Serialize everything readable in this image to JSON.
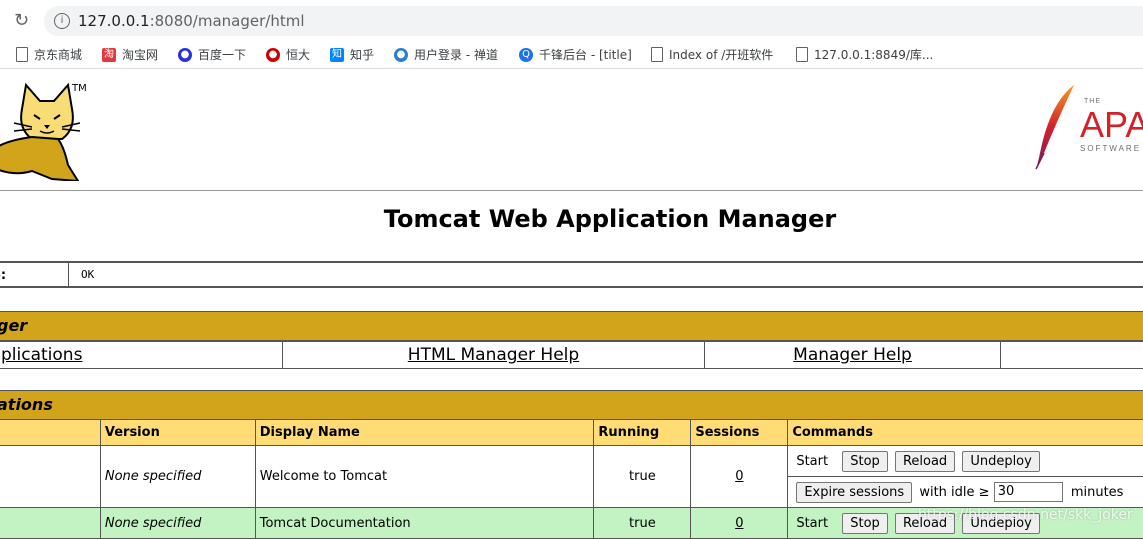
{
  "browser": {
    "url_host": "127.0.0.1",
    "url_rest": ":8080/manager/html",
    "bookmarks": [
      "京东商城",
      "淘宝网",
      "百度一下",
      "恒大",
      "知乎",
      "用户登录 - 禅道",
      "千锋后台 - [title]",
      "Index of /开班软件",
      "127.0.0.1:8849/库..."
    ]
  },
  "header": {
    "title": "Tomcat Web Application Manager",
    "tm": "TM"
  },
  "message": {
    "label": "e:",
    "value": "OK"
  },
  "manager_section": {
    "title": "ger",
    "links": [
      "plications",
      "HTML Manager Help",
      "Manager Help"
    ]
  },
  "apps_section": {
    "title": "ations",
    "columns": [
      "",
      "Version",
      "Display Name",
      "Running",
      "Sessions",
      "Commands"
    ],
    "rows": [
      {
        "version": "None specified",
        "display_name": "Welcome to Tomcat",
        "running": "true",
        "sessions": "0"
      },
      {
        "version": "None specified",
        "display_name": "Tomcat Documentation",
        "running": "true",
        "sessions": "0"
      }
    ],
    "commands": {
      "start": "Start",
      "stop": "Stop",
      "reload": "Reload",
      "undeploy": "Undeploy",
      "expire": "Expire sessions",
      "idle_label": "with idle ≥",
      "idle_value": "30",
      "minutes": "minutes"
    }
  },
  "watermark": "https://blog.csdn.net/skk_joker",
  "colors": {
    "section_header": "#D2A41C",
    "table_header": "#FFDC75",
    "alt_row": "#C3F3C3"
  }
}
